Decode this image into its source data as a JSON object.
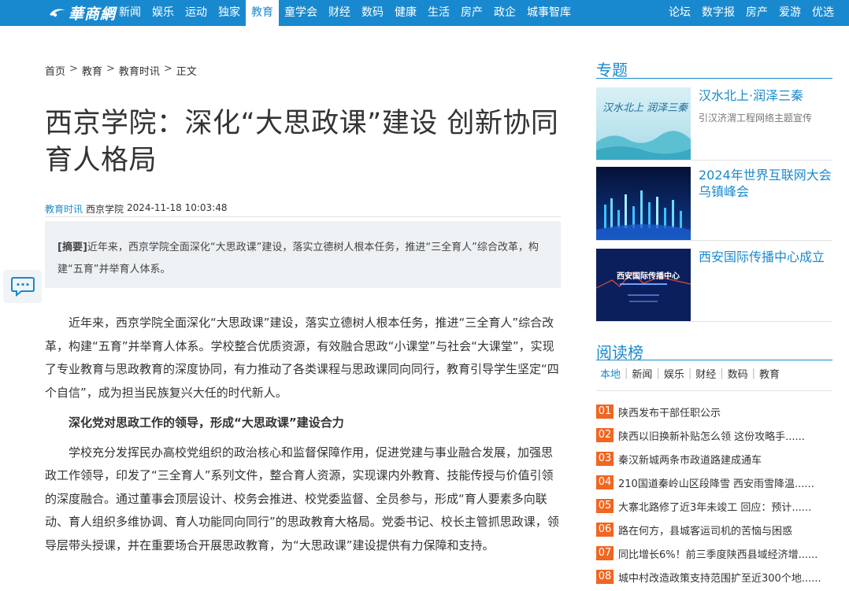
{
  "nav": {
    "logo_text": "華商網",
    "left": [
      "新闻",
      "娱乐",
      "运动",
      "独家",
      "教育",
      "童学会",
      "财经",
      "数码",
      "健康",
      "生活",
      "房产",
      "政企",
      "城事智库"
    ],
    "right": [
      "论坛",
      "数字报",
      "房产",
      "爱游",
      "优选"
    ],
    "active": "教育"
  },
  "breadcrumb": [
    "首页",
    "教育",
    "教育时讯",
    "正文"
  ],
  "article": {
    "title": "西京学院：深化“大思政课”建设 创新协同育人格局",
    "category": "教育时讯",
    "source": "西京学院",
    "datetime": "2024-11-18 10:03:48",
    "abstract_label": "[摘要]",
    "abstract_text": "近年来，西京学院全面深化“大思政课”建设，落实立德树人根本任务，推进“三全育人”综合改革，构建“五育”并举育人体系。",
    "paragraphs": [
      "近年来，西京学院全面深化“大思政课”建设，落实立德树人根本任务，推进“三全育人”综合改革，构建“五育”并举育人体系。学校整合优质资源，有效融合思政“小课堂”与社会“大课堂”，实现了专业教育与思政教育的深度协同，有力推动了各类课程与思政课同向同行，教育引导学生坚定“四个自信”，成为担当民族复兴大任的时代新人。",
      "深化党对思政工作的领导，形成“大思政课”建设合力",
      "学校充分发挥民办高校党组织的政治核心和监督保障作用，促进党建与事业融合发展，加强思政工作领导，印发了“三全育人”系列文件，整合育人资源，实现课内外教育、技能传授与价值引领的深度融合。通过董事会顶层设计、校务会推进、校党委监督、全员参与，形成“育人要素多向联动、育人组织多维协调、育人功能同向同行”的思政教育大格局。党委书记、校长主管抓思政课，领导层带头授课，并在重要场合开展思政教育，为“大思政课”建设提供有力保障和支持。"
    ]
  },
  "sidebar": {
    "topics_title": "专题",
    "topics": [
      {
        "title": "汉水北上·润泽三秦",
        "desc": "引汉济渭工程网络主题宣传",
        "thumb_text": "汉水北上 润泽三秦"
      },
      {
        "title": "2024年世界互联网大会乌镇峰会",
        "desc": "",
        "thumb_text": ""
      },
      {
        "title": "西安国际传播中心成立",
        "desc": "",
        "thumb_text": "西安国际传播中心"
      }
    ],
    "ranking_title": "阅读榜",
    "tabs": [
      "本地",
      "新闻",
      "娱乐",
      "财经",
      "数码",
      "教育"
    ],
    "active_tab": "本地",
    "ranking": [
      {
        "num": "01",
        "text": "陕西发布干部任职公示"
      },
      {
        "num": "02",
        "text": "陕西以旧换新补贴怎么领 这份攻略手......"
      },
      {
        "num": "03",
        "text": "秦汉新城两条市政道路建成通车"
      },
      {
        "num": "04",
        "text": "210国道秦岭山区段降雪 西安雨雪降温......"
      },
      {
        "num": "05",
        "text": "大寨北路修了近3年未竣工 回应：预计......"
      },
      {
        "num": "06",
        "text": "路在何方，县城客运司机的苦恼与困惑"
      },
      {
        "num": "07",
        "text": "同比增长6%！前三季度陕西县域经济增......"
      },
      {
        "num": "08",
        "text": "城中村改造政策支持范围扩至近300个地......"
      }
    ],
    "colors": {
      "accent": "#1989cf",
      "rank": "#f06622"
    }
  },
  "floating": {
    "icon": "chat-icon"
  }
}
